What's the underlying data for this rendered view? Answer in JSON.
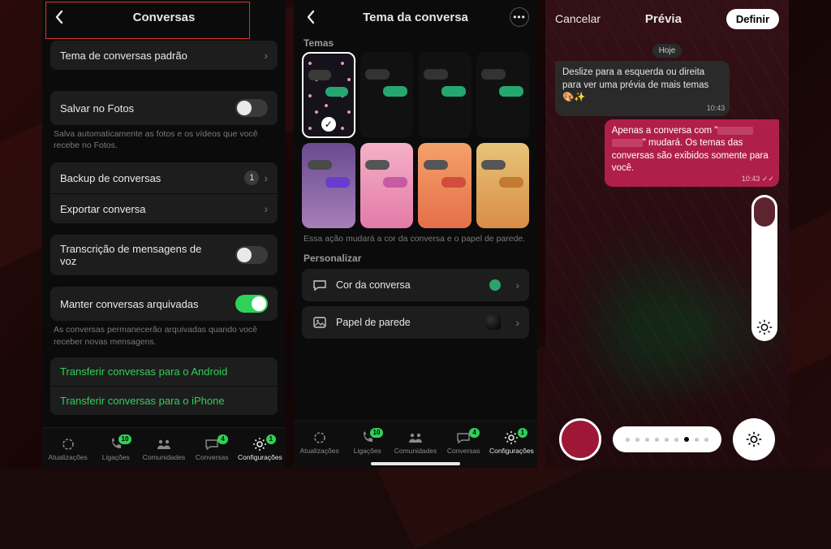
{
  "tabbar": {
    "items": [
      {
        "label": "Atualizações"
      },
      {
        "label": "Ligações",
        "badge": "10"
      },
      {
        "label": "Comunidades"
      },
      {
        "label": "Conversas",
        "badge": "4"
      },
      {
        "label": "Configurações",
        "badge": "1"
      }
    ]
  },
  "screen1": {
    "title": "Conversas",
    "rows": {
      "theme": {
        "label": "Tema de conversas padrão"
      },
      "savePhotos": {
        "label": "Salvar no Fotos",
        "on": false,
        "caption": "Salva automaticamente as fotos e os vídeos que você recebe no Fotos."
      },
      "backup": {
        "label": "Backup de conversas",
        "badge": "1"
      },
      "export": {
        "label": "Exportar conversa"
      },
      "transcribe": {
        "label": "Transcrição de mensagens de voz",
        "on": false
      },
      "keepArchived": {
        "label": "Manter conversas arquivadas",
        "on": true,
        "caption": "As conversas permanecerão arquivadas quando você receber novas mensagens."
      },
      "transferAndroid": {
        "label": "Transferir conversas para o Android"
      },
      "transferIphone": {
        "label": "Transferir conversas para o iPhone"
      }
    }
  },
  "screen2": {
    "title": "Tema da conversa",
    "section_themes": "Temas",
    "note": "Essa ação mudará a cor da conversa e o papel de parede.",
    "section_personalize": "Personalizar",
    "chatColor": {
      "label": "Cor da conversa"
    },
    "wallpaper": {
      "label": "Papel de parede"
    },
    "themes": [
      {
        "bg": "#1a1320",
        "in": "#3a3a3a",
        "out": "#25a870",
        "selected": true,
        "pattern": true
      },
      {
        "bg": "#111",
        "in": "#333",
        "out": "#25a870"
      },
      {
        "bg": "#111",
        "in": "#333",
        "out": "#25a870"
      },
      {
        "bg": "#111",
        "in": "#333",
        "out": "#25a870"
      },
      {
        "bg": "linear-gradient(#6a4a8f,#a57fb8)",
        "in": "#4a4a4a",
        "out": "#6a3bd1"
      },
      {
        "bg": "linear-gradient(#f4b1c6,#e37aa8)",
        "in": "#555",
        "out": "#c65aa3"
      },
      {
        "bg": "linear-gradient(#f3a26a,#e56f4a)",
        "in": "#555",
        "out": "#d24d3c"
      },
      {
        "bg": "linear-gradient(#e8c478,#d88d46)",
        "in": "#555",
        "out": "#c47a2f"
      }
    ]
  },
  "screen3": {
    "cancel": "Cancelar",
    "title": "Prévia",
    "action": "Definir",
    "day": "Hoje",
    "msg_in": {
      "text": "Deslize para a esquerda ou direita para ver uma prévia de mais temas 🎨✨",
      "time": "10:43"
    },
    "msg_out": {
      "prefix": "Apenas a conversa com \"",
      "suffix": "\" mudará. Os temas das conversas são exibidos somente para você.",
      "time": "10:43"
    },
    "pager": {
      "count": 9,
      "current": 6
    }
  }
}
